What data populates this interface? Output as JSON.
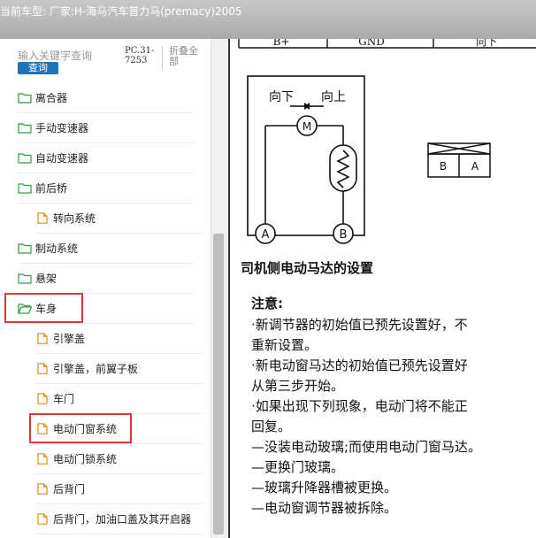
{
  "window": {
    "title": "当前车型: 厂家:H-海马汽车普力马(premacy)2005"
  },
  "search": {
    "placeholder": "输入关键字查询",
    "button": "查询",
    "code": "PC.31-7253",
    "collapse": "折叠全部"
  },
  "tree": [
    {
      "label": "离合器",
      "level": 1,
      "type": "folder",
      "open": false
    },
    {
      "label": "手动变速器",
      "level": 1,
      "type": "folder",
      "open": false
    },
    {
      "label": "自动变速器",
      "level": 1,
      "type": "folder",
      "open": false
    },
    {
      "label": "前后桥",
      "level": 1,
      "type": "folder",
      "open": false
    },
    {
      "label": "转向系统",
      "level": 2,
      "type": "file"
    },
    {
      "label": "制动系统",
      "level": 1,
      "type": "folder",
      "open": false
    },
    {
      "label": "悬架",
      "level": 1,
      "type": "folder",
      "open": false
    },
    {
      "label": "车身",
      "level": 1,
      "type": "folder",
      "open": true,
      "highlighted": true
    },
    {
      "label": "引擎盖",
      "level": 2,
      "type": "file"
    },
    {
      "label": "引擎盖，前翼子板",
      "level": 2,
      "type": "file"
    },
    {
      "label": "车门",
      "level": 2,
      "type": "file"
    },
    {
      "label": "电动门窗系统",
      "level": 2,
      "type": "file",
      "highlighted": true
    },
    {
      "label": "电动门锁系统",
      "level": 2,
      "type": "file"
    },
    {
      "label": "后背门",
      "level": 2,
      "type": "file"
    },
    {
      "label": "后背门，加油口盖及其开启器",
      "level": 2,
      "type": "file"
    }
  ],
  "document": {
    "table_header": [
      "B+",
      "GND",
      "向下"
    ],
    "diagram": {
      "down": "向下",
      "up": "向上",
      "motor": "M",
      "term_a": "A",
      "term_b": "B",
      "conn_b": "B",
      "conn_a": "A"
    },
    "heading": "司机侧电动马达的设置",
    "note_title": "注意:",
    "lines": [
      "·新调节器的初始值已预先设置好，不",
      "  重新设置。",
      "·新电动窗马达的初始值已预先设置好",
      "  从第三步开始。",
      "·如果出现下列现象，电动门将不能正",
      "  回复。",
      "  —没装电动玻璃;而使用电动门窗马达。",
      "  —更换门玻璃。",
      "  —玻璃升降器槽被更换。",
      "  —电动窗调节器被拆除。"
    ]
  },
  "colors": {
    "highlight": "#d9383a",
    "button": "#1e73be",
    "folder": "#2e9e3e",
    "file": "#e08a1e"
  }
}
